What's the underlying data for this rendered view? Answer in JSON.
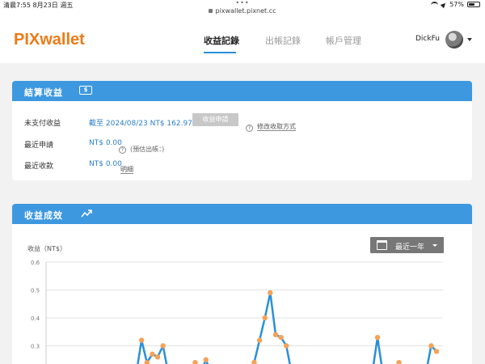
{
  "status_bar": {
    "time": "清晨7:55  8月23日 週五",
    "url": "pixwallet.pixnet.cc",
    "battery": "57%",
    "battery_level": 0.57
  },
  "header": {
    "logo": "PIXwallet",
    "nav": [
      "收益記錄",
      "出帳記錄",
      "帳戶管理"
    ],
    "active_nav": 0,
    "username": "DickFu"
  },
  "settlement": {
    "title": "結算收益",
    "unpaid_label": "未支付收益",
    "unpaid_value": "截至 2024/08/23 NT$ 162.97",
    "apply_button": "收益申請",
    "help": "?",
    "modify_link": "修改收取方式",
    "recent_apply_label": "最近申請",
    "recent_apply_value": "NT$ 0.00",
    "estimate_note": "(預估出帳：)",
    "recent_receive_label": "最近收款",
    "recent_receive_value": "NT$ 0.00",
    "detail_link": "明細"
  },
  "performance": {
    "title": "收益成效",
    "range_select": "最近一年"
  },
  "colors": {
    "brand_orange": "#ef7a16",
    "accent_blue": "#3d98e0",
    "line_blue": "#2b8fd8",
    "point_orange": "#f4a259"
  },
  "chart_data": {
    "type": "line",
    "ylabel": "收益（NT$）",
    "ylim": [
      0.2,
      0.6
    ],
    "yticks": [
      "0.6",
      "0.5",
      "0.4",
      "0.3"
    ],
    "grid": true,
    "x": [
      0,
      1,
      2,
      3,
      4,
      5,
      6,
      7,
      8,
      9,
      10,
      11,
      12,
      13,
      14,
      15,
      16,
      17,
      18,
      19,
      20,
      21,
      22,
      23,
      24,
      25,
      26,
      27,
      28,
      29,
      30,
      31,
      32,
      33,
      34,
      35,
      36,
      37,
      38,
      39,
      40,
      41,
      42,
      43,
      44,
      45,
      46,
      47,
      48,
      49,
      50,
      51,
      52,
      53,
      54,
      55,
      56,
      57,
      58,
      59,
      60,
      61,
      62,
      63,
      64,
      65,
      66,
      67,
      68,
      69,
      70,
      71
    ],
    "values": [
      0.2,
      0.2,
      0.2,
      0.2,
      0.2,
      0.2,
      0.2,
      0.2,
      0.2,
      0.2,
      0.2,
      0.2,
      0.2,
      0.2,
      0.2,
      0.2,
      0.32,
      0.24,
      0.27,
      0.26,
      0.3,
      0.2,
      0.2,
      0.2,
      0.2,
      0.2,
      0.24,
      0.2,
      0.25,
      0.2,
      0.2,
      0.2,
      0.2,
      0.2,
      0.2,
      0.2,
      0.2,
      0.24,
      0.32,
      0.4,
      0.49,
      0.34,
      0.33,
      0.3,
      0.2,
      0.2,
      0.2,
      0.2,
      0.2,
      0.2,
      0.2,
      0.2,
      0.2,
      0.2,
      0.2,
      0.2,
      0.2,
      0.2,
      0.2,
      0.2,
      0.33,
      0.2,
      0.2,
      0.2,
      0.24,
      0.2,
      0.2,
      0.2,
      0.2,
      0.2,
      0.3,
      0.28
    ]
  }
}
